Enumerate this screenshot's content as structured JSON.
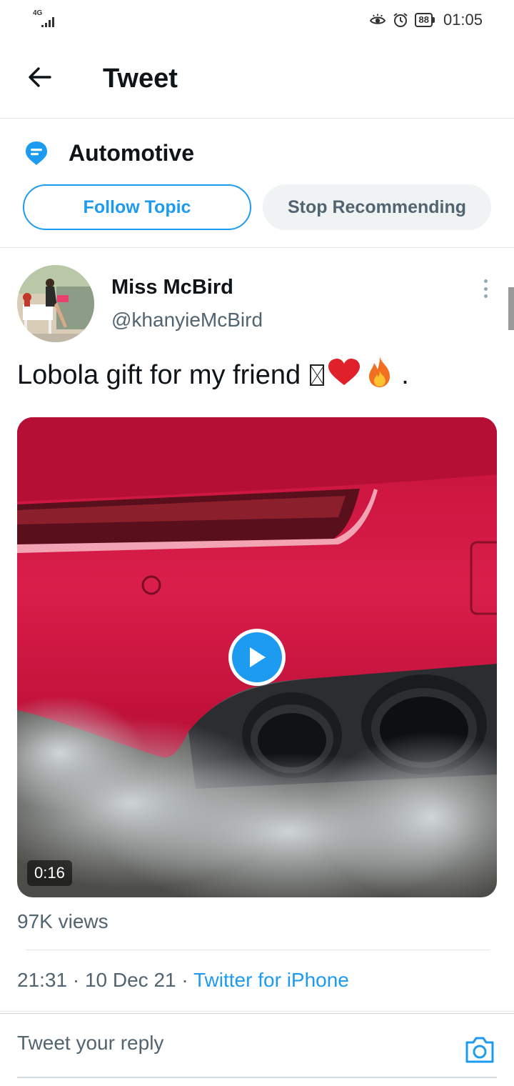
{
  "status_bar": {
    "network": "4G",
    "battery": "88",
    "time": "01:05"
  },
  "header": {
    "title": "Tweet",
    "back_icon": "arrow-left-icon"
  },
  "topic": {
    "name": "Automotive",
    "icon": "topic-icon",
    "follow_label": "Follow Topic",
    "stop_label": "Stop Recommending"
  },
  "tweet": {
    "author_name": "Miss McBird",
    "author_handle": "@khanyieMcBird",
    "text": "Lobola gift for my friend ",
    "text_end": ".",
    "media": {
      "duration": "0:16"
    },
    "views": "97K views",
    "time": "21:31",
    "date": "10 Dec 21",
    "separator": "·",
    "source": "Twitter for iPhone"
  },
  "reply": {
    "placeholder": "Tweet your reply",
    "camera_icon": "camera-icon"
  },
  "colors": {
    "accent": "#1d9bf0",
    "secondary_text": "#536471",
    "stop_button_bg": "#eff3f4"
  }
}
